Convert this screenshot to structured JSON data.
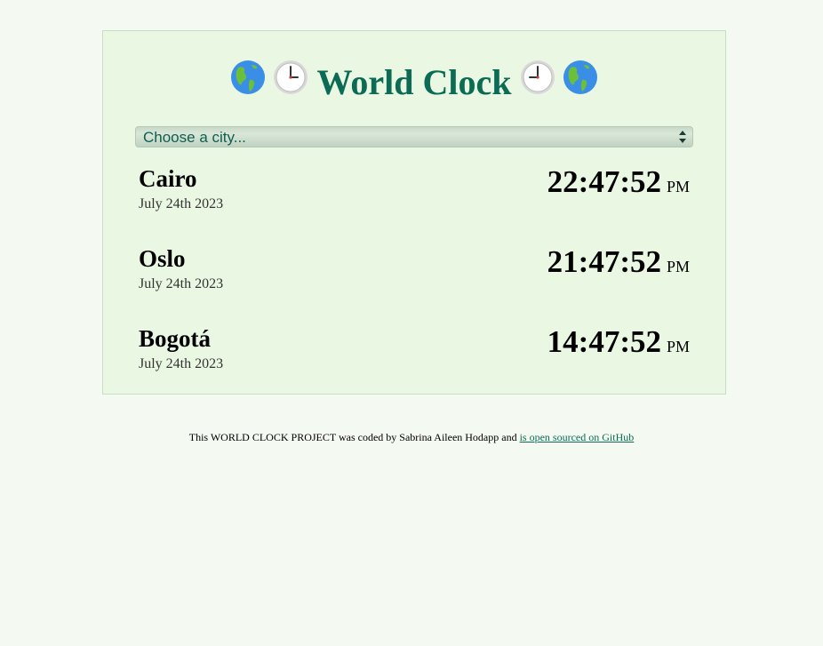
{
  "header": {
    "title": "World Clock",
    "left_icons": [
      "globe-americas-icon",
      "clock-icon"
    ],
    "right_icons": [
      "clock-icon",
      "globe-americas-icon"
    ],
    "title_color": "#0c6b55"
  },
  "city_select": {
    "placeholder": "Choose a city..."
  },
  "cities": [
    {
      "name": "Cairo",
      "date": "July 24th 2023",
      "time": "22:47:52",
      "ampm": "PM"
    },
    {
      "name": "Oslo",
      "date": "July 24th 2023",
      "time": "21:47:52",
      "ampm": "PM"
    },
    {
      "name": "Bogotá",
      "date": "July 24th 2023",
      "time": "14:47:52",
      "ampm": "PM"
    }
  ],
  "footer": {
    "text": "This WORLD CLOCK PROJECT was coded by Sabrina Aileen Hodapp and",
    "link_text": "is open sourced on GitHub"
  },
  "colors": {
    "page_bg": "#f4f9f1",
    "card_bg": "#eaf7e2",
    "accent": "#0c6b55"
  }
}
